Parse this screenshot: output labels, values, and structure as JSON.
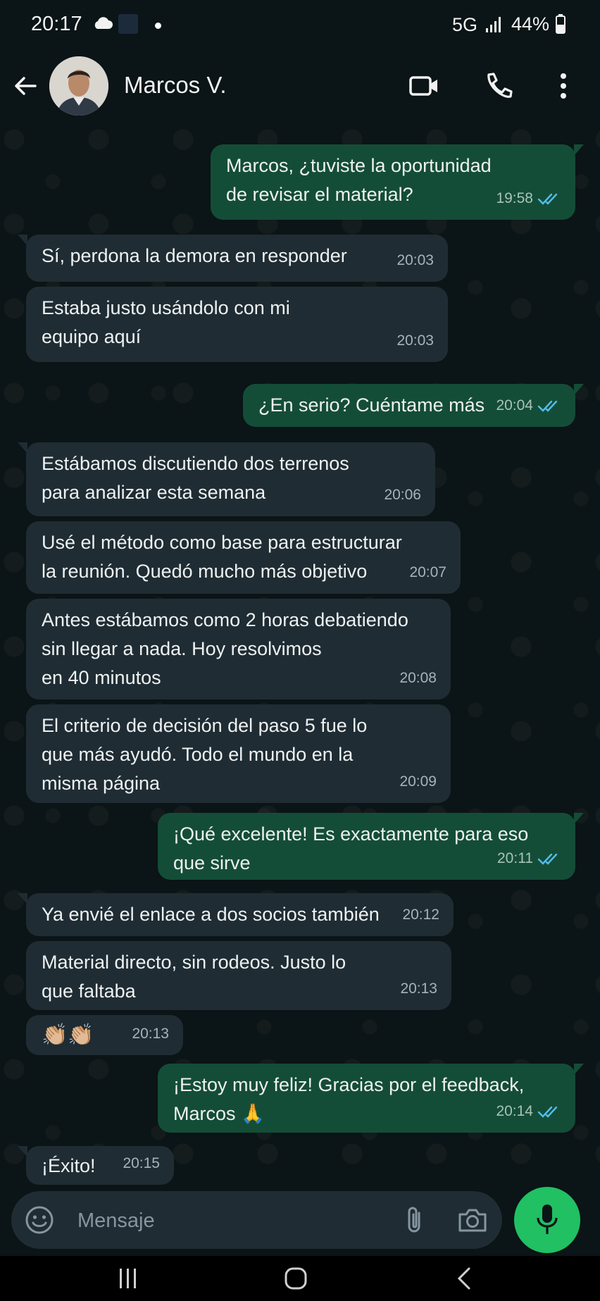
{
  "status_bar": {
    "time": "20:17",
    "network": "5G",
    "battery": "44%"
  },
  "header": {
    "contact_name": "Marcos V."
  },
  "messages": [
    {
      "text": "Marcos, ¿tuviste la oportunidad\nde revisar el material?",
      "time": "19:58",
      "outgoing": true,
      "read": true
    },
    {
      "text": "Sí, perdona la demora en responder",
      "time": "20:03",
      "outgoing": false
    },
    {
      "text": "Estaba justo usándolo con mi\nequipo aquí",
      "time": "20:03",
      "outgoing": false
    },
    {
      "text": "¿En serio? Cuéntame más",
      "time": "20:04",
      "outgoing": true,
      "read": true
    },
    {
      "text": "Estábamos discutiendo dos terrenos\npara analizar esta semana",
      "time": "20:06",
      "outgoing": false
    },
    {
      "text": "Usé el método como base para estructurar\nla reunión. Quedó mucho más objetivo",
      "time": "20:07",
      "outgoing": false
    },
    {
      "text": "Antes estábamos como 2 horas debatiendo\nsin llegar a nada. Hoy resolvimos\nen 40 minutos",
      "time": "20:08",
      "outgoing": false
    },
    {
      "text": "El criterio de decisión del paso 5 fue lo\nque más ayudó. Todo el mundo en la\nmisma página",
      "time": "20:09",
      "outgoing": false
    },
    {
      "text": "¡Qué excelente! Es exactamente para eso\nque sirve",
      "time": "20:11",
      "outgoing": true,
      "read": true
    },
    {
      "text": "Ya envié el enlace a dos socios también",
      "time": "20:12",
      "outgoing": false
    },
    {
      "text": "Material directo, sin rodeos. Justo lo\nque faltaba",
      "time": "20:13",
      "outgoing": false
    },
    {
      "text": "👏🏼👏🏼",
      "time": "20:13",
      "outgoing": false
    },
    {
      "text": "¡Estoy muy feliz! Gracias por el feedback,\nMarcos 🙏",
      "time": "20:14",
      "outgoing": true,
      "read": true
    },
    {
      "text": "¡Éxito!",
      "time": "20:15",
      "outgoing": false
    }
  ],
  "composer": {
    "placeholder": "Mensaje"
  },
  "colors": {
    "outgoing_bubble": "#144d37",
    "incoming_bubble": "#1f2c33",
    "mic_button": "#21c063",
    "read_ticks": "#53bdeb"
  },
  "icons": [
    "back-arrow-icon",
    "video-call-icon",
    "voice-call-icon",
    "more-options-icon",
    "emoji-icon",
    "attach-icon",
    "camera-icon",
    "mic-icon"
  ]
}
